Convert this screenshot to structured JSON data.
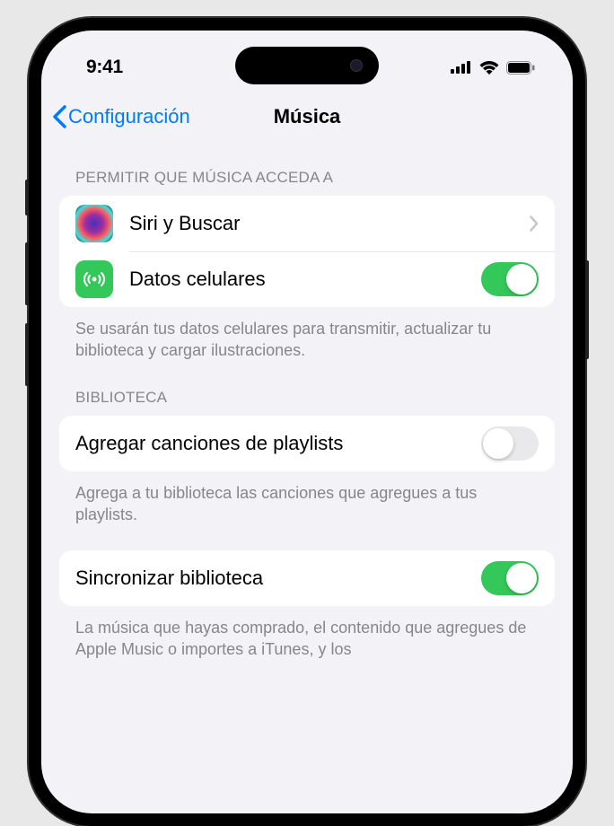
{
  "status": {
    "time": "9:41"
  },
  "nav": {
    "back": "Configuración",
    "title": "Música"
  },
  "sections": {
    "access": {
      "header": "Permitir que Música acceda a",
      "siri_label": "Siri y Buscar",
      "cellular_label": "Datos celulares",
      "cellular_on": true,
      "footer": "Se usarán tus datos celulares para transmitir, actualizar tu biblioteca y cargar ilustraciones."
    },
    "library": {
      "header": "Biblioteca",
      "add_playlist_label": "Agregar canciones de playlists",
      "add_playlist_on": false,
      "add_playlist_footer": "Agrega a tu biblioteca las canciones que agregues a tus playlists.",
      "sync_label": "Sincronizar biblioteca",
      "sync_on": true,
      "sync_footer": "La música que hayas comprado, el contenido que agregues de Apple Music o importes a iTunes, y los"
    }
  },
  "colors": {
    "accent": "#007aff",
    "toggle_on": "#34c759",
    "bg": "#f2f2f7"
  }
}
